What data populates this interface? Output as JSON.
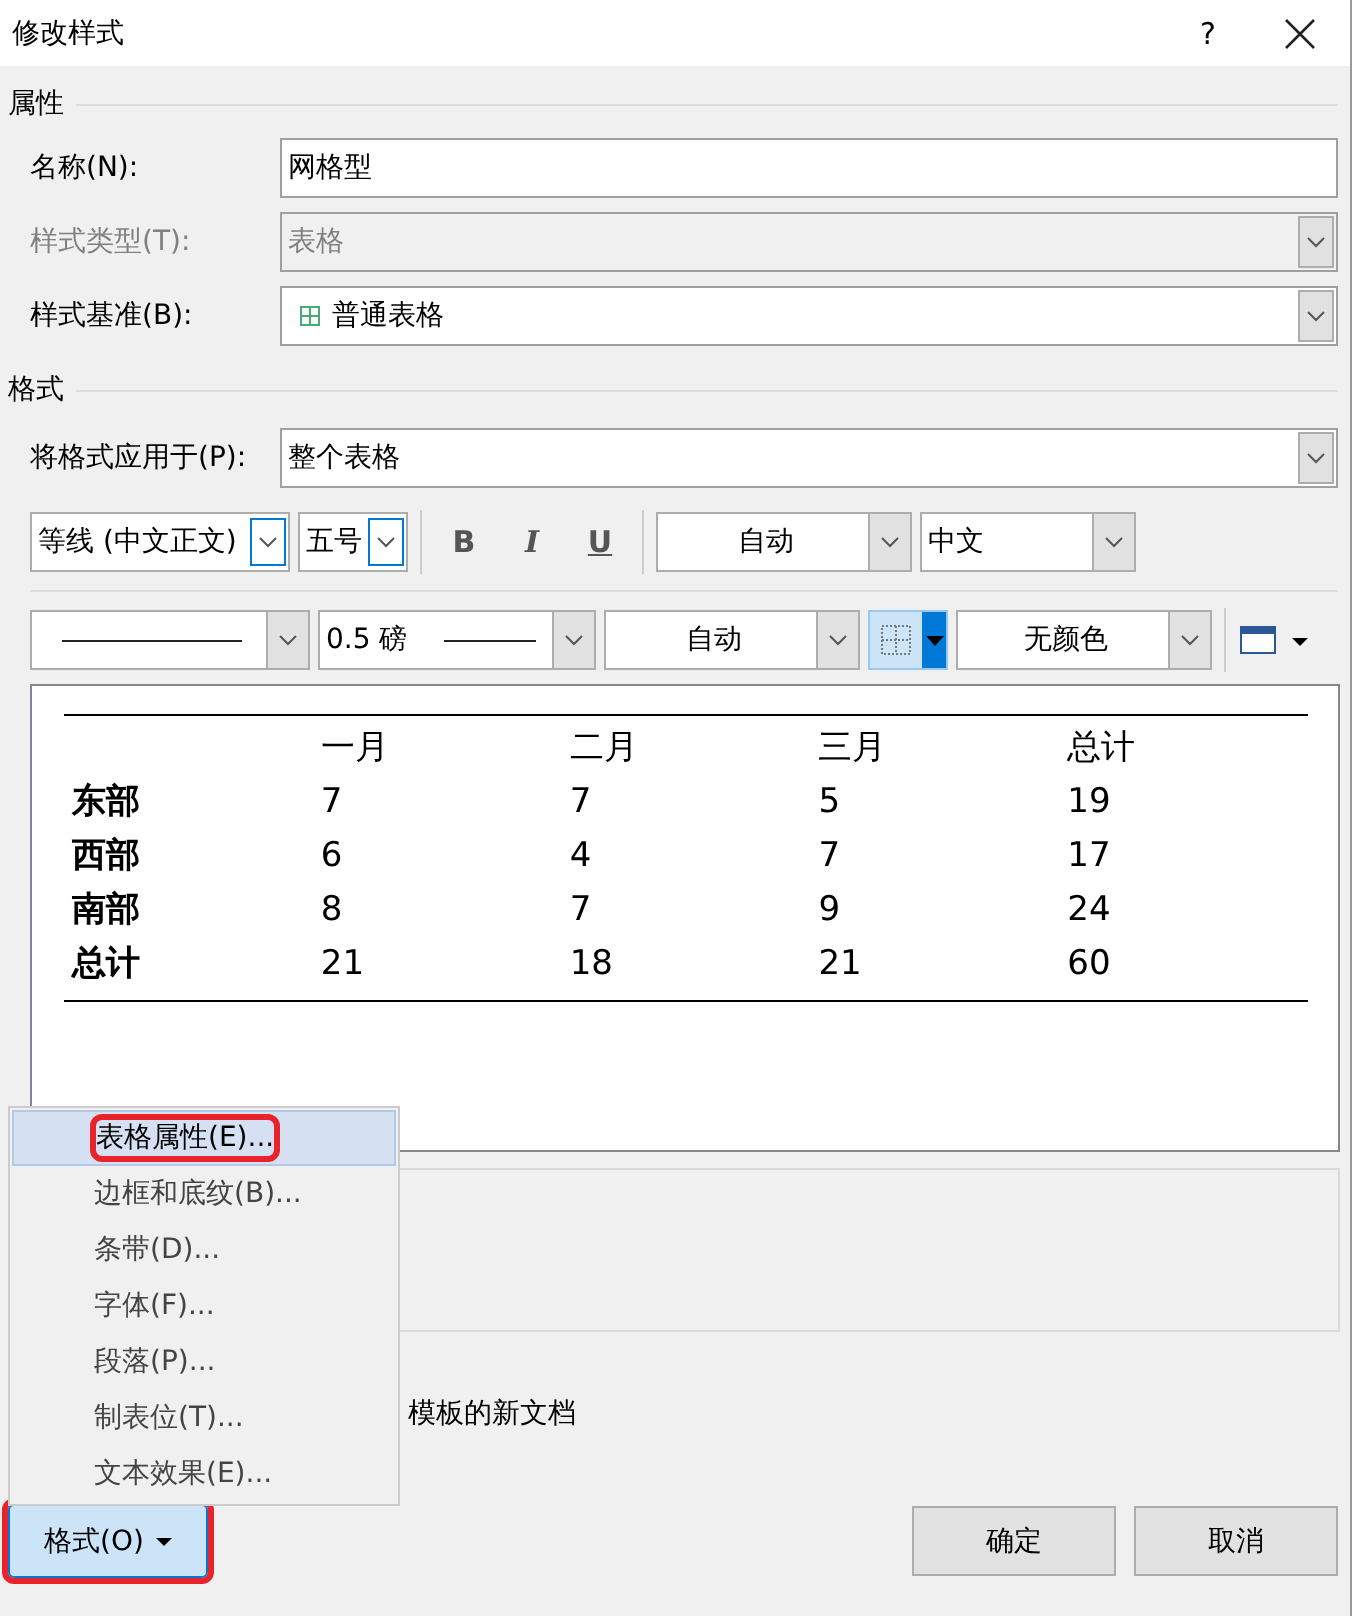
{
  "window": {
    "title": "修改样式",
    "help": "?"
  },
  "properties": {
    "heading": "属性",
    "fields": [
      {
        "label": "名称(N):",
        "value": "网格型",
        "disabled": false,
        "dropdown": false,
        "table_icon": false
      },
      {
        "label": "样式类型(T):",
        "value": "表格",
        "disabled": true,
        "dropdown": true,
        "table_icon": false
      },
      {
        "label": "样式基准(B):",
        "value": "普通表格",
        "disabled": false,
        "dropdown": true,
        "table_icon": true
      }
    ]
  },
  "formatting": {
    "heading": "格式",
    "apply_to": {
      "label": "将格式应用于(P):",
      "value": "整个表格"
    },
    "font": "等线 (中文正文)",
    "size": "五号",
    "bold": "B",
    "italic": "I",
    "underline": "U",
    "font_color": "自动",
    "script": "中文",
    "border_width": "0.5 磅",
    "border_color": "自动",
    "shading": "无颜色"
  },
  "preview": {
    "header": [
      "一月",
      "二月",
      "三月",
      "总计"
    ],
    "rows": [
      [
        "东部",
        "7",
        "7",
        "5",
        "19"
      ],
      [
        "西部",
        "6",
        "4",
        "7",
        "17"
      ],
      [
        "南部",
        "8",
        "7",
        "9",
        "24"
      ],
      [
        "总计",
        "21",
        "18",
        "21",
        "60"
      ]
    ]
  },
  "description_tail": "模板的新文档",
  "format_menu": {
    "items": [
      {
        "label": "表格属性(E)...",
        "selected": true,
        "annotated": true
      },
      {
        "label": "边框和底纹(B)...",
        "selected": false,
        "annotated": false
      },
      {
        "label": "条带(D)...",
        "selected": false,
        "annotated": false
      },
      {
        "label": "字体(F)...",
        "selected": false,
        "annotated": false
      },
      {
        "label": "段落(P)...",
        "selected": false,
        "annotated": false
      },
      {
        "label": "制表位(T)...",
        "selected": false,
        "annotated": false
      },
      {
        "label": "文本效果(E)...",
        "selected": false,
        "annotated": false
      }
    ]
  },
  "buttons": {
    "format": {
      "label": "格式(O)",
      "annotated": true
    },
    "ok": "确定",
    "cancel": "取消"
  }
}
